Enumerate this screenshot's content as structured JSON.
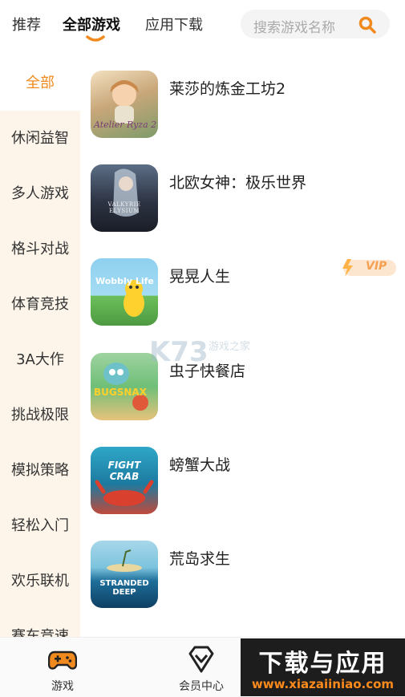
{
  "top_tabs": {
    "recommend": "推荐",
    "all_games": "全部游戏",
    "app_download": "应用下载"
  },
  "search": {
    "placeholder": "搜索游戏名称",
    "icon": "search-icon"
  },
  "sidebar": {
    "items": [
      {
        "label": "全部"
      },
      {
        "label": "休闲益智"
      },
      {
        "label": "多人游戏"
      },
      {
        "label": "格斗对战"
      },
      {
        "label": "体育竞技"
      },
      {
        "label": "3A大作"
      },
      {
        "label": "挑战极限"
      },
      {
        "label": "模拟策略"
      },
      {
        "label": "轻松入门"
      },
      {
        "label": "欢乐联机"
      },
      {
        "label": "赛车竞速"
      }
    ]
  },
  "games": [
    {
      "title": "莱莎的炼金工坊2",
      "cover_text": "Atelier Ryza 2"
    },
    {
      "title": "北欧女神：极乐世界",
      "cover_text": "VALKYRIE ELYSIUM"
    },
    {
      "title": "晃晃人生",
      "cover_text": "Wobbly Life",
      "vip": "VIP"
    },
    {
      "title": "虫子快餐店",
      "cover_text": "BUGSNAX"
    },
    {
      "title": "螃蟹大战",
      "cover_text": "FIGHT CRAB"
    },
    {
      "title": "荒岛求生",
      "cover_text": "STRANDED DEEP"
    }
  ],
  "watermark": {
    "text": "K73",
    "sub": "游戏之家"
  },
  "bottom_nav": {
    "games": "游戏",
    "vip_center": "会员中心"
  },
  "brand": {
    "line1": "下载与应用",
    "line2": "www.xiazaiiniao.com"
  },
  "colors": {
    "accent": "#f08a1e",
    "sidebar_bg": "#fdf5ea"
  }
}
